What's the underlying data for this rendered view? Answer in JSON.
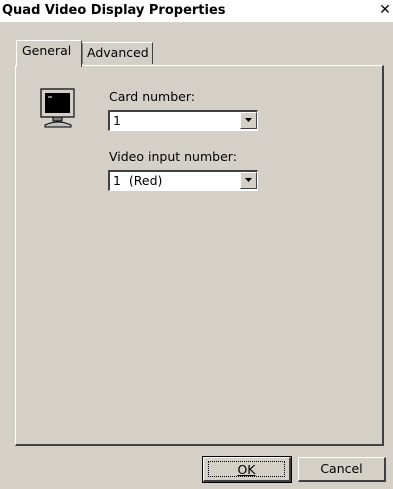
{
  "window": {
    "title": "Quad Video Display Properties",
    "close_glyph": "✕"
  },
  "tabs": [
    {
      "label": "General",
      "active": true
    },
    {
      "label": "Advanced",
      "active": false
    }
  ],
  "general": {
    "icon": "monitor-icon",
    "card_number": {
      "label": "Card number:",
      "value": "1"
    },
    "video_input": {
      "label": "Video input number:",
      "value": "1  (Red)"
    }
  },
  "buttons": {
    "ok": "OK",
    "cancel": "Cancel"
  }
}
